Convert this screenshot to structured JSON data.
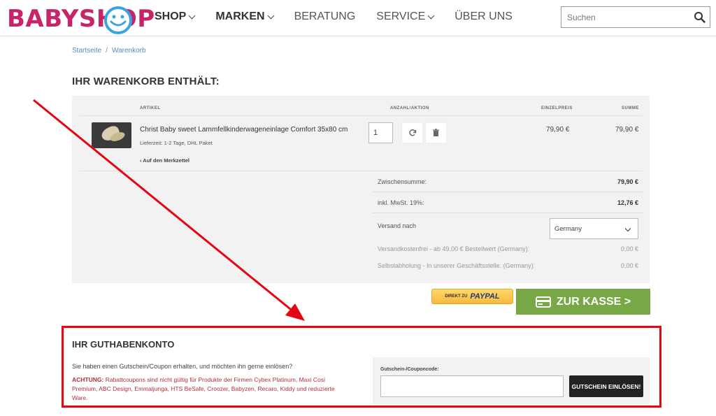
{
  "header": {
    "logo": "BABYSHOP",
    "nav": [
      {
        "label": "SHOP",
        "dropdown": true
      },
      {
        "label": "MARKEN",
        "dropdown": true
      },
      {
        "label": "BERATUNG",
        "dropdown": false
      },
      {
        "label": "SERVICE",
        "dropdown": true
      },
      {
        "label": "ÜBER UNS",
        "dropdown": false
      }
    ],
    "search_placeholder": "Suchen"
  },
  "breadcrumb": {
    "home": "Startseite",
    "separator": "/",
    "current": "Warenkorb"
  },
  "cart": {
    "title": "IHR WARENKORB ENTHÄLT:",
    "columns": {
      "article": "ARTIKEL",
      "qty_action": "ANZAHL/AKTION",
      "unit_price": "EINZELPREIS",
      "total": "SUMME"
    },
    "item": {
      "name": "Christ Baby sweet Lammfellkinderwageneinlage Comfort 35x80 cm",
      "delivery": "Lieferzeit: 1-2 Tage, DHL Paket",
      "wishlist_link": "‹ Auf den Merkzettel",
      "quantity": "1",
      "unit_price": "79,90 €",
      "total": "79,90 €"
    },
    "summary": {
      "subtotal_label": "Zwischensumme:",
      "subtotal": "79,90 €",
      "vat_label": "inkl. MwSt. 19%:",
      "vat": "12,76 €",
      "shipping_label": "Versand nach",
      "country": "Germany",
      "free_shipping_label": "Versandkostenfrei - ab 49,00 € Bestellwert (Germany):",
      "free_shipping": "0,00 €",
      "pickup_label": "Selbstabholung - In unserer Geschäftsstelle. (Germany):",
      "pickup": "0,00 €"
    },
    "paypal": {
      "prefix": "DIREKT ZU",
      "brand": "PAYPAL"
    },
    "checkout": "ZUR KASSE >"
  },
  "voucher": {
    "title": "IHR GUTHABENKONTO",
    "question": "Sie haben einen Gutschein/Coupon erhalten, und möchten ihn gerne einlösen?",
    "warning_label": "ACHTUNG:",
    "warning_text": "Rabattcoupons sind nicht gültig für Produkte der Firmen Cybex Platinum, Maxi Cosi Premium, ABC Design, Emmaljunga, HTS BeSafe, Croozer, Babyzen, Recaro, Kiddy und reduzierte Ware.",
    "code_label": "Gutschein-/Couponcode:",
    "code_value": "",
    "redeem": "GUTSCHEIN EINLÖSEN!"
  },
  "colors": {
    "brand": "#c8246a",
    "smile": "#3aa3e0",
    "checkout": "#78a745",
    "annotation": "#e30613",
    "warning": "#b3303a"
  }
}
